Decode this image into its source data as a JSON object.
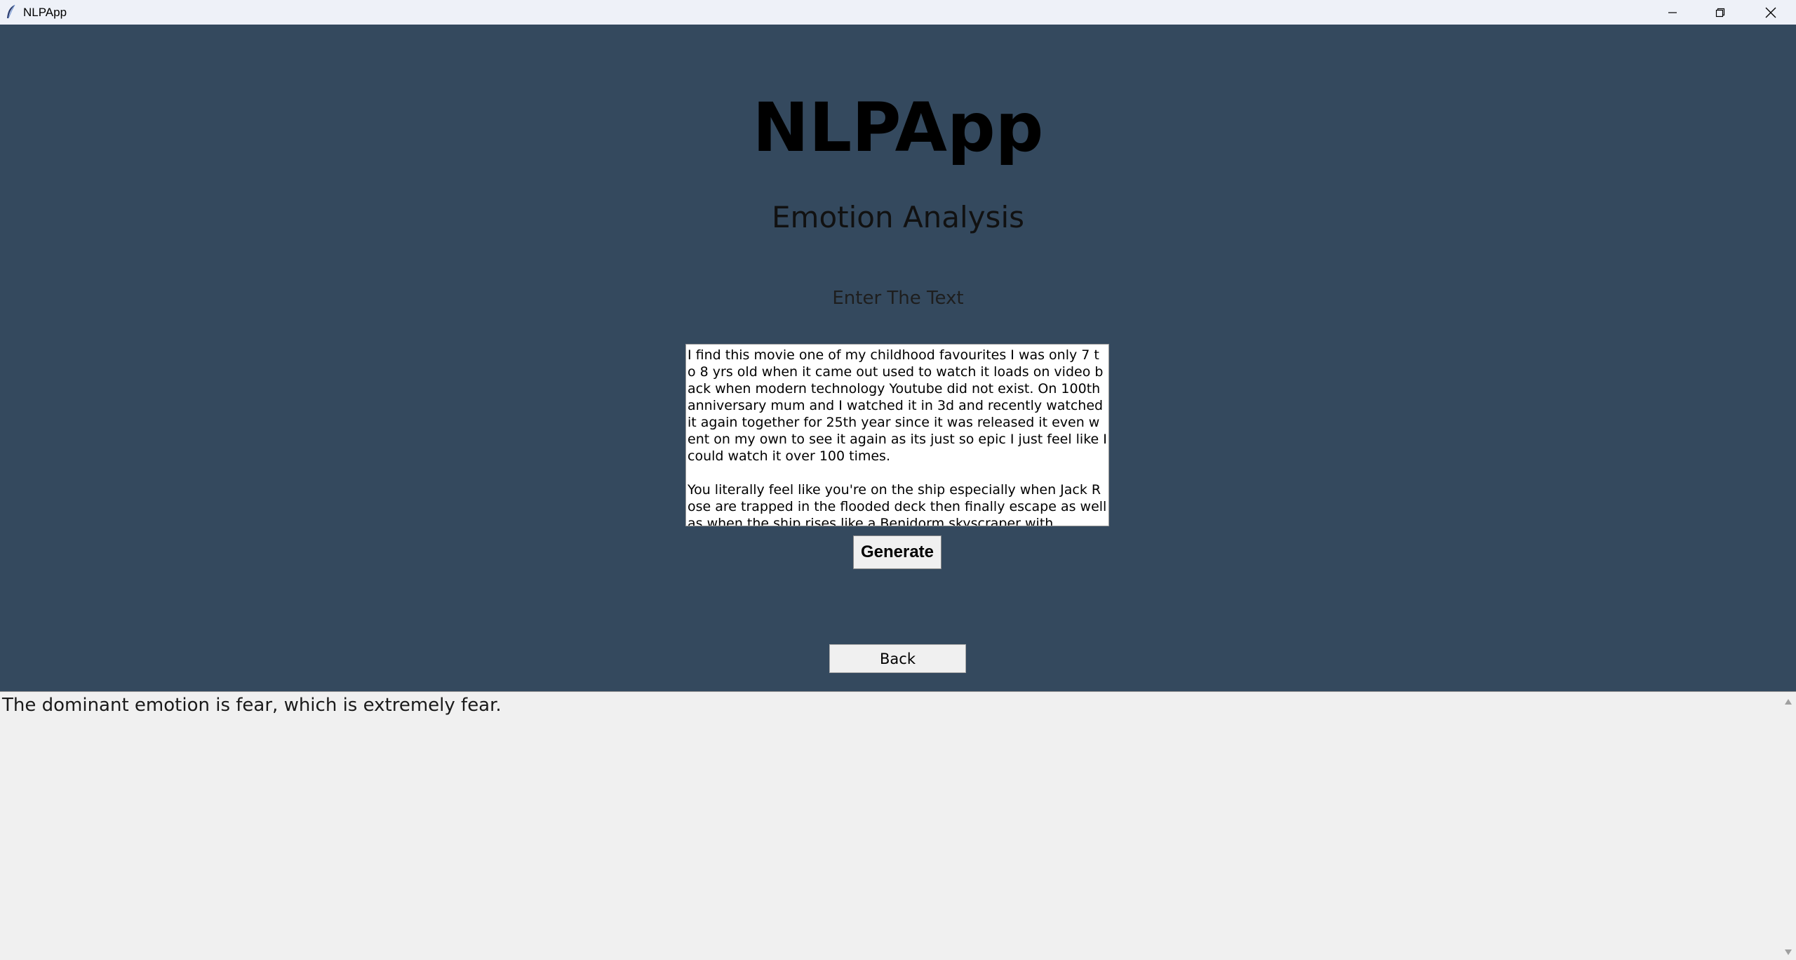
{
  "window": {
    "title": "NLPApp",
    "icon": "feather-icon",
    "controls": [
      "minimize-icon",
      "restore-icon",
      "close-icon"
    ]
  },
  "main": {
    "app_title": "NLPApp",
    "subtitle": "Emotion Analysis",
    "prompt_label": "Enter The Text",
    "input_text": "I find this movie one of my childhood favourites I was only 7 to 8 yrs old when it came out used to watch it loads on video back when modern technology Youtube did not exist. On 100th anniversary mum and I watched it in 3d and recently watched it again together for 25th year since it was released it even went on my own to see it again as its just so epic I just feel like I could watch it over 100 times.\n\nYou literally feel like you're on the ship especially when Jack Rose are trapped in the flooded deck then finally escape as well as when the ship rises like a Benidorm skyscraper with",
    "generate_label": "Generate",
    "back_label": "Back"
  },
  "output": {
    "result_text": "The dominant emotion is fear, which is extremely fear."
  },
  "colors": {
    "background": "#34495e",
    "titlebar": "#eef1f8",
    "output_bg": "#f0f0f0"
  }
}
